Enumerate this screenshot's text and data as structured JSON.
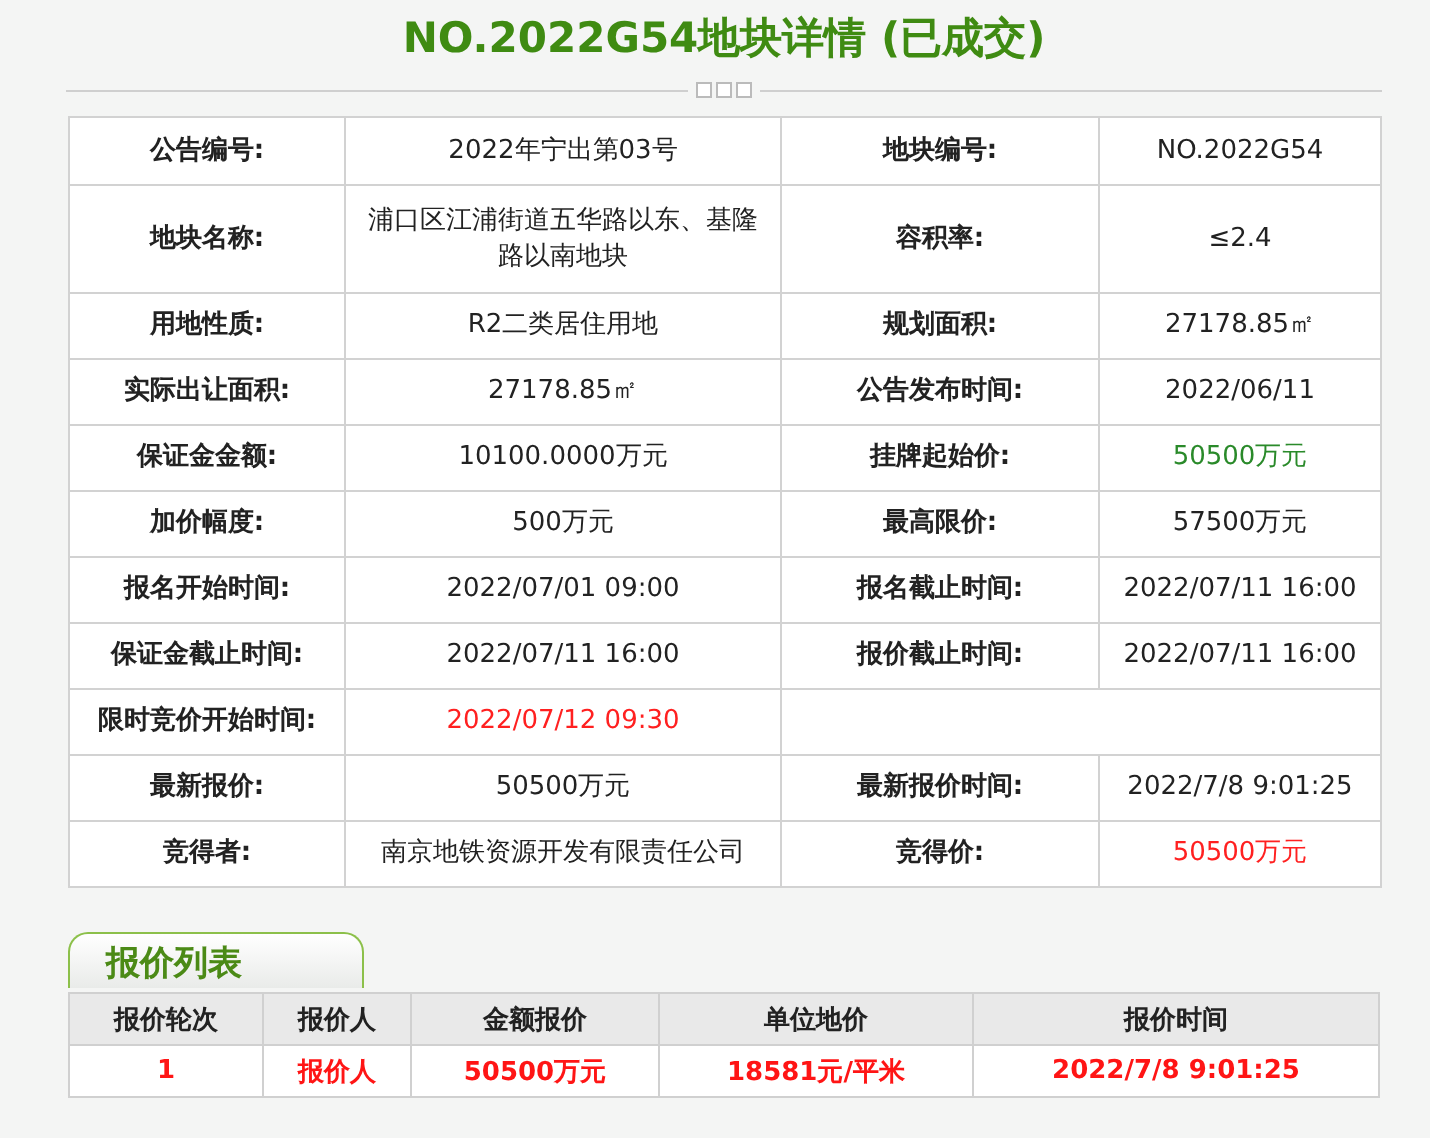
{
  "title": "NO.2022G54地块详情 (已成交)",
  "details": [
    {
      "cells": [
        {
          "label": "公告编号:",
          "value": "2022年宁出第03号",
          "color": "#222222"
        },
        {
          "label": "地块编号:",
          "value": "NO.2022G54",
          "color": "#222222"
        }
      ]
    },
    {
      "cells": [
        {
          "label": "地块名称:",
          "value": "浦口区江浦街道五华路以东、基隆路以南地块",
          "color": "#222222"
        },
        {
          "label": "容积率:",
          "value": "≤2.4",
          "color": "#222222"
        }
      ]
    },
    {
      "cells": [
        {
          "label": "用地性质:",
          "value": "R2二类居住用地",
          "color": "#222222"
        },
        {
          "label": "规划面积:",
          "value": "27178.85㎡",
          "color": "#222222"
        }
      ]
    },
    {
      "cells": [
        {
          "label": "实际出让面积:",
          "value": "27178.85㎡",
          "color": "#222222"
        },
        {
          "label": "公告发布时间:",
          "value": "2022/06/11",
          "color": "#222222"
        }
      ]
    },
    {
      "cells": [
        {
          "label": "保证金金额:",
          "value": "10100.0000万元",
          "color": "#222222"
        },
        {
          "label": "挂牌起始价:",
          "value": "50500万元",
          "color": "#2a8a2a"
        }
      ]
    },
    {
      "cells": [
        {
          "label": "加价幅度:",
          "value": "500万元",
          "color": "#222222"
        },
        {
          "label": "最高限价:",
          "value": "57500万元",
          "color": "#222222"
        }
      ]
    },
    {
      "cells": [
        {
          "label": "报名开始时间:",
          "value": "2022/07/01 09:00",
          "color": "#222222"
        },
        {
          "label": "报名截止时间:",
          "value": "2022/07/11 16:00",
          "color": "#222222"
        }
      ]
    },
    {
      "cells": [
        {
          "label": "保证金截止时间:",
          "value": "2022/07/11 16:00",
          "color": "#222222"
        },
        {
          "label": "报价截止时间:",
          "value": "2022/07/11 16:00",
          "color": "#222222"
        }
      ]
    },
    {
      "cells": [
        {
          "label": "限时竞价开始时间:",
          "value": "2022/07/12 09:30",
          "color": "#ff2020"
        }
      ]
    },
    {
      "cells": [
        {
          "label": "最新报价:",
          "value": "50500万元",
          "color": "#222222"
        },
        {
          "label": "最新报价时间:",
          "value": "2022/7/8 9:01:25",
          "color": "#222222"
        }
      ]
    },
    {
      "cells": [
        {
          "label": "竞得者:",
          "value": "南京地铁资源开发有限责任公司",
          "color": "#222222"
        },
        {
          "label": "竞得价:",
          "value": "50500万元",
          "color": "#ff2020"
        }
      ]
    }
  ],
  "bids": {
    "tab": "报价列表",
    "columns": [
      "报价轮次",
      "报价人",
      "金额报价",
      "单位地价",
      "报价时间"
    ],
    "rows": [
      [
        "1",
        "报价人",
        "50500万元",
        "18581元/平米",
        "2022/7/8 9:01:25"
      ]
    ]
  }
}
